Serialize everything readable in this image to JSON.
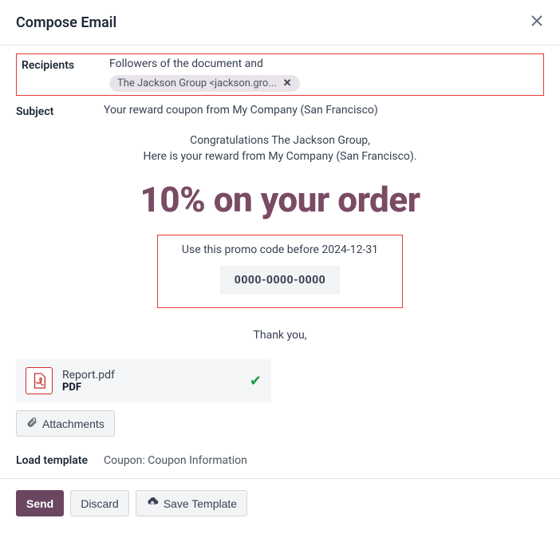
{
  "header": {
    "title": "Compose Email"
  },
  "fields": {
    "recipients": {
      "label": "Recipients",
      "text": "Followers of the document and",
      "chip": "The Jackson Group <jackson.gro..."
    },
    "subject": {
      "label": "Subject",
      "value": "Your reward coupon from My Company (San Francisco)"
    },
    "loadTemplate": {
      "label": "Load template",
      "value": "Coupon: Coupon Information"
    }
  },
  "emailBody": {
    "congrats": "Congratulations The Jackson Group,",
    "rewardLine": "Here is your reward from My Company (San Francisco).",
    "discountHeadline": "10% on your order",
    "promoText": "Use this promo code before 2024-12-31",
    "promoCode": "0000-0000-0000",
    "thankyou": "Thank you,"
  },
  "attachment": {
    "name": "Report.pdf",
    "type": "PDF"
  },
  "buttons": {
    "attachments": "Attachments",
    "send": "Send",
    "discard": "Discard",
    "saveTemplate": "Save Template"
  }
}
